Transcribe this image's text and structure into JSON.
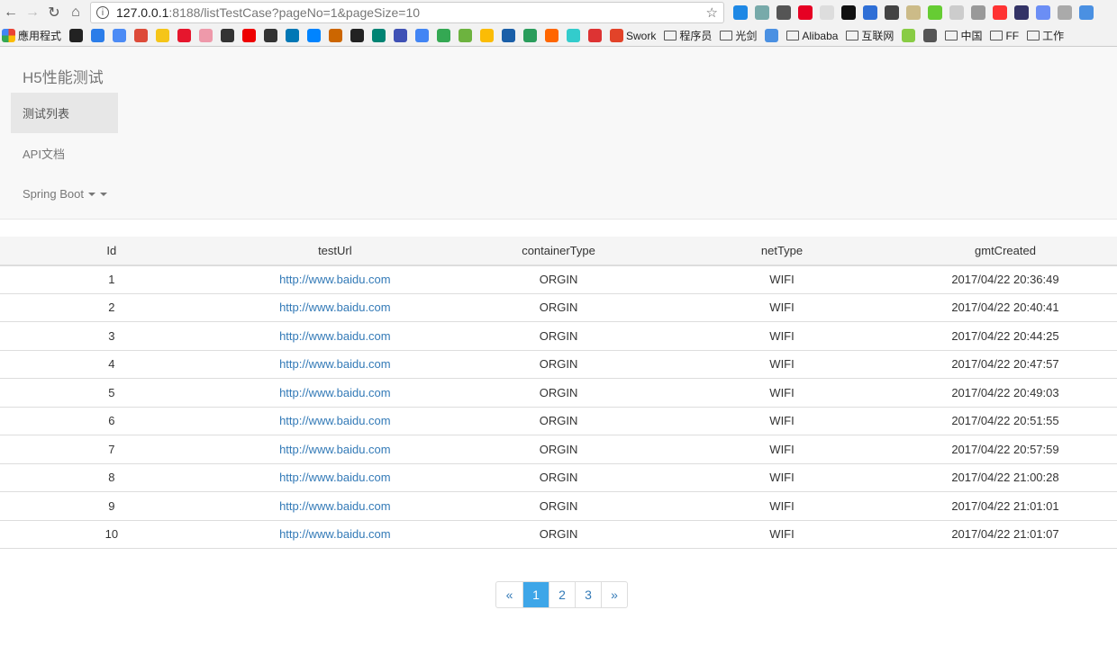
{
  "browser": {
    "url_host": "127.0.0.1",
    "url_path": ":8188/listTestCase?pageNo=1&pageSize=10",
    "extensions": [
      "#1e88e5",
      "#7aa",
      "#555",
      "#e60023",
      "#ddd",
      "#111",
      "#2f6fd6",
      "#444",
      "#cb8",
      "#6c3",
      "#ccc",
      "#999",
      "#f33",
      "#336",
      "#6b8ef5",
      "#aaa",
      "#4a90e2"
    ],
    "bookmarks": [
      {
        "label": "應用程式",
        "type": "apps"
      },
      {
        "label": "",
        "type": "icon",
        "color": "#222"
      },
      {
        "label": "",
        "type": "icon",
        "color": "#2b7de9"
      },
      {
        "label": "",
        "type": "icon",
        "color": "#4c8bf5"
      },
      {
        "label": "",
        "type": "icon",
        "color": "#dd4b39"
      },
      {
        "label": "",
        "type": "icon",
        "color": "#f5c518"
      },
      {
        "label": "",
        "type": "icon",
        "color": "#e6162d"
      },
      {
        "label": "",
        "type": "icon",
        "color": "#e9a"
      },
      {
        "label": "",
        "type": "icon",
        "color": "#333"
      },
      {
        "label": "",
        "type": "icon",
        "color": "#e00"
      },
      {
        "label": "",
        "type": "icon",
        "color": "#333"
      },
      {
        "label": "",
        "type": "icon",
        "color": "#0077b5"
      },
      {
        "label": "",
        "type": "icon",
        "color": "#0084ff"
      },
      {
        "label": "",
        "type": "icon",
        "color": "#c60"
      },
      {
        "label": "",
        "type": "icon",
        "color": "#222"
      },
      {
        "label": "",
        "type": "icon",
        "color": "#008373"
      },
      {
        "label": "",
        "type": "icon",
        "color": "#3f51b5"
      },
      {
        "label": "",
        "type": "icon",
        "color": "#4285f4"
      },
      {
        "label": "",
        "type": "icon",
        "color": "#34a853"
      },
      {
        "label": "",
        "type": "icon",
        "color": "#6db33f"
      },
      {
        "label": "",
        "type": "icon",
        "color": "#fbbc05"
      },
      {
        "label": "",
        "type": "icon",
        "color": "#1a5fa8"
      },
      {
        "label": "",
        "type": "icon",
        "color": "#2a9d5c"
      },
      {
        "label": "",
        "type": "icon",
        "color": "#f60"
      },
      {
        "label": "",
        "type": "icon",
        "color": "#3cc"
      },
      {
        "label": "",
        "type": "icon",
        "color": "#d33"
      },
      {
        "label": "Swork",
        "type": "icon",
        "color": "#e24329"
      },
      {
        "label": "程序员",
        "type": "folder"
      },
      {
        "label": "光剑",
        "type": "folder"
      },
      {
        "label": "",
        "type": "icon",
        "color": "#4a90e2"
      },
      {
        "label": "Alibaba",
        "type": "folder"
      },
      {
        "label": "互联网",
        "type": "folder"
      },
      {
        "label": "",
        "type": "icon",
        "color": "#8c4"
      },
      {
        "label": "",
        "type": "icon",
        "color": "#555"
      },
      {
        "label": "中国",
        "type": "folder"
      },
      {
        "label": "FF",
        "type": "folder"
      },
      {
        "label": "工作",
        "type": "folder"
      }
    ]
  },
  "nav": {
    "brand": "H5性能测试",
    "items": [
      {
        "label": "测试列表",
        "active": true
      },
      {
        "label": "API文档"
      },
      {
        "label": "Spring Boot"
      }
    ]
  },
  "table": {
    "headers": [
      "Id",
      "testUrl",
      "containerType",
      "netType",
      "gmtCreated"
    ],
    "rows": [
      [
        "1",
        "http://www.baidu.com",
        "ORGIN",
        "WIFI",
        "2017/04/22 20:36:49"
      ],
      [
        "2",
        "http://www.baidu.com",
        "ORGIN",
        "WIFI",
        "2017/04/22 20:40:41"
      ],
      [
        "3",
        "http://www.baidu.com",
        "ORGIN",
        "WIFI",
        "2017/04/22 20:44:25"
      ],
      [
        "4",
        "http://www.baidu.com",
        "ORGIN",
        "WIFI",
        "2017/04/22 20:47:57"
      ],
      [
        "5",
        "http://www.baidu.com",
        "ORGIN",
        "WIFI",
        "2017/04/22 20:49:03"
      ],
      [
        "6",
        "http://www.baidu.com",
        "ORGIN",
        "WIFI",
        "2017/04/22 20:51:55"
      ],
      [
        "7",
        "http://www.baidu.com",
        "ORGIN",
        "WIFI",
        "2017/04/22 20:57:59"
      ],
      [
        "8",
        "http://www.baidu.com",
        "ORGIN",
        "WIFI",
        "2017/04/22 21:00:28"
      ],
      [
        "9",
        "http://www.baidu.com",
        "ORGIN",
        "WIFI",
        "2017/04/22 21:01:01"
      ],
      [
        "10",
        "http://www.baidu.com",
        "ORGIN",
        "WIFI",
        "2017/04/22 21:01:07"
      ]
    ]
  },
  "pagination": {
    "prev": "«",
    "pages": [
      "1",
      "2",
      "3"
    ],
    "current": "1",
    "next": "»",
    "active_color": "#3ea6e8"
  }
}
